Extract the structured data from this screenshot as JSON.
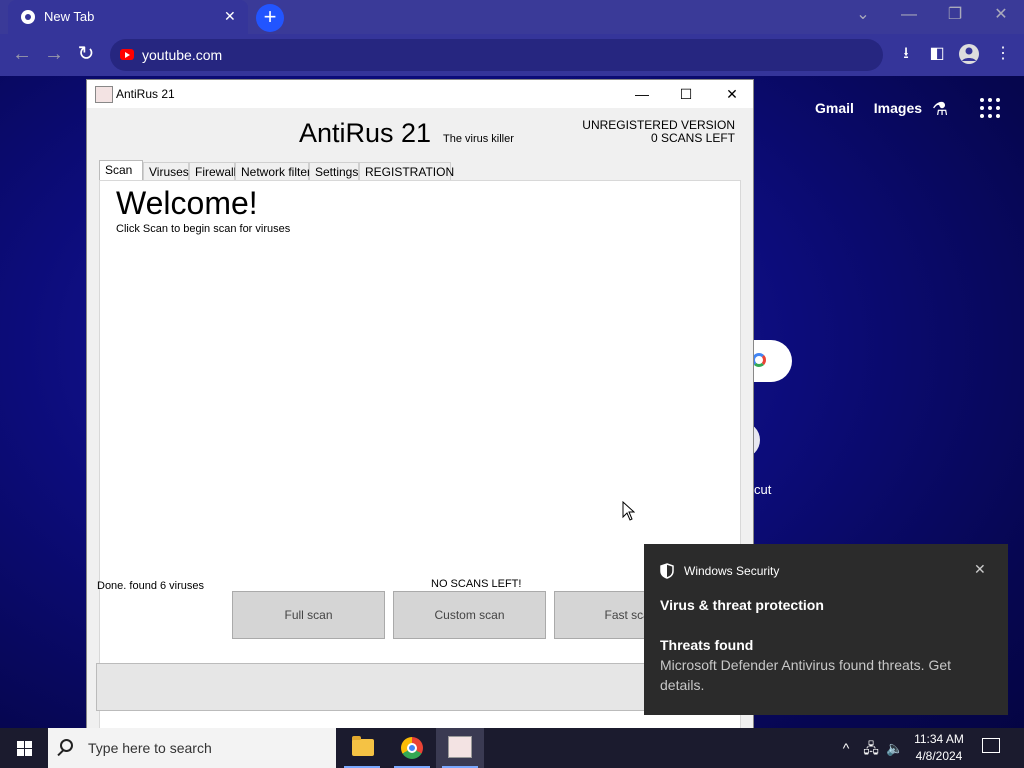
{
  "browser": {
    "tab_title": "New Tab",
    "url": "youtube.com",
    "ntp_links": {
      "gmail": "Gmail",
      "images": "Images"
    },
    "shortcut_label": "cut"
  },
  "antirus": {
    "window_title": "AntiRus 21",
    "brand": "AntiRus 21",
    "tagline": "The virus killer",
    "version": "UNREGISTERED VERSION",
    "scans_left": "0 SCANS LEFT",
    "tabs": [
      "Scan",
      "Viruses",
      "Firewall",
      "Network filter",
      "Settings",
      "REGISTRATION"
    ],
    "active_tab": "Scan",
    "welcome": "Welcome!",
    "hint": "Click Scan to begin scan for viruses",
    "buttons": {
      "full": "Full scan",
      "custom": "Custom scan",
      "fast": "Fast scan"
    },
    "status": "Done. found 6 viruses",
    "no_scans": "NO SCANS LEFT!"
  },
  "toast": {
    "app": "Windows Security",
    "heading": "Virus & threat protection",
    "subheading": "Threats found",
    "body": "Microsoft Defender Antivirus found threats. Get details."
  },
  "taskbar": {
    "search_placeholder": "Type here to search",
    "time": "11:34 AM",
    "date": "4/8/2024"
  },
  "colors": {
    "chrome_frame": "#3a3a98",
    "desktop": "#0c0c7a",
    "toast_bg": "#2b2b2b",
    "new_tab_button": "#2255ff"
  }
}
